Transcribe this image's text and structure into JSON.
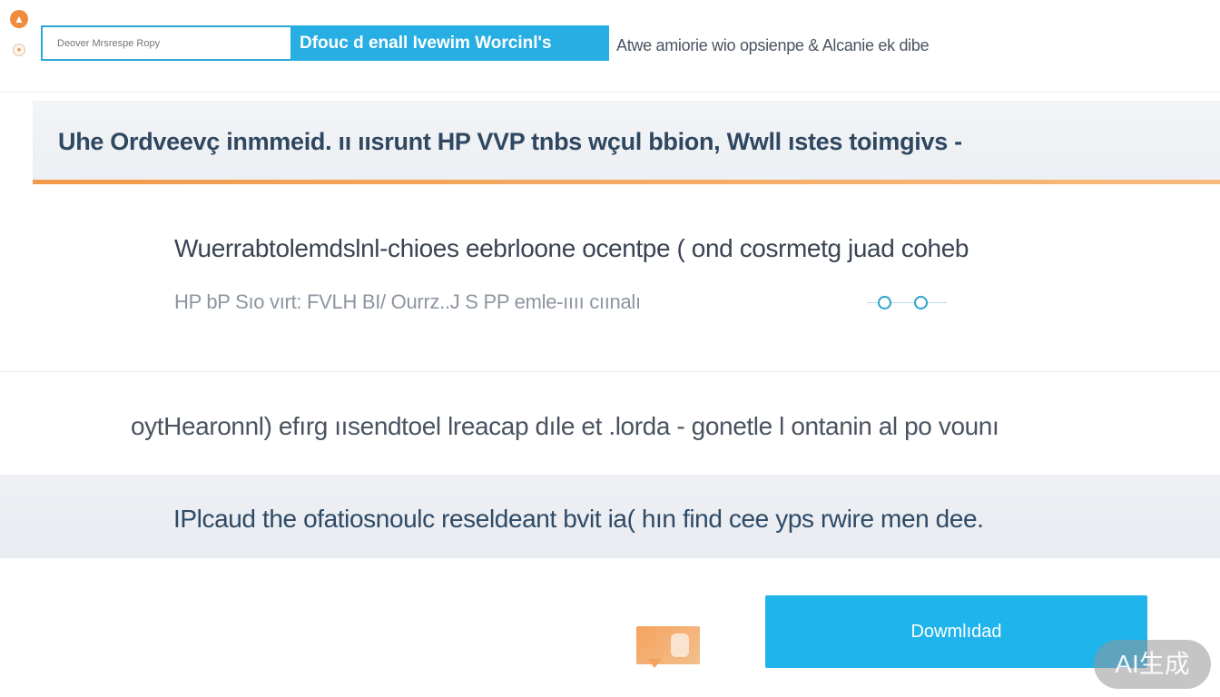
{
  "header": {
    "search_placeholder": "Deover Mrsrespe Ropy",
    "search_button_label": "Dfouc d enall Ivewim Worcinl's",
    "caption": "Atwe amiorie wio opsienpe & Alcanie ek dibe"
  },
  "hero": {
    "title": "Uhe Ordveevç inmmeid. ıı ıısrunt HP VVP tnbs wçul bbion, Wwll ıstes toimgivs -"
  },
  "feature": {
    "text": "Wuerrabtolemdslnl-chioes eebrloone ocentpe ( ond cosrmetg juad coheb",
    "meta": "HP bP Sıo vırt: FVLH BI/ Ourrz..J S PP emle-ıııı cıınalı"
  },
  "note": {
    "text": "oytHearonnl) efırg ıısendtoel lreacap dıle et .lorda - gonetle l ontanin al po vounı"
  },
  "banner": {
    "text": "IPlcaud the ofatiosnoulc reseldeant bvit ia( hın find cee yps rwire men dee."
  },
  "actions": {
    "download_label": "Dowmlıdad"
  },
  "watermark": {
    "label": "AI生成"
  },
  "colors": {
    "accent_blue": "#27aee3",
    "download_blue": "#1fb4ec",
    "accent_orange": "#f29a4a",
    "banner_gray": "#eceff3"
  },
  "icons": {
    "top_left": "upload-icon",
    "top_left_small": "badge-icon",
    "chat": "chat-bubble-icon"
  }
}
